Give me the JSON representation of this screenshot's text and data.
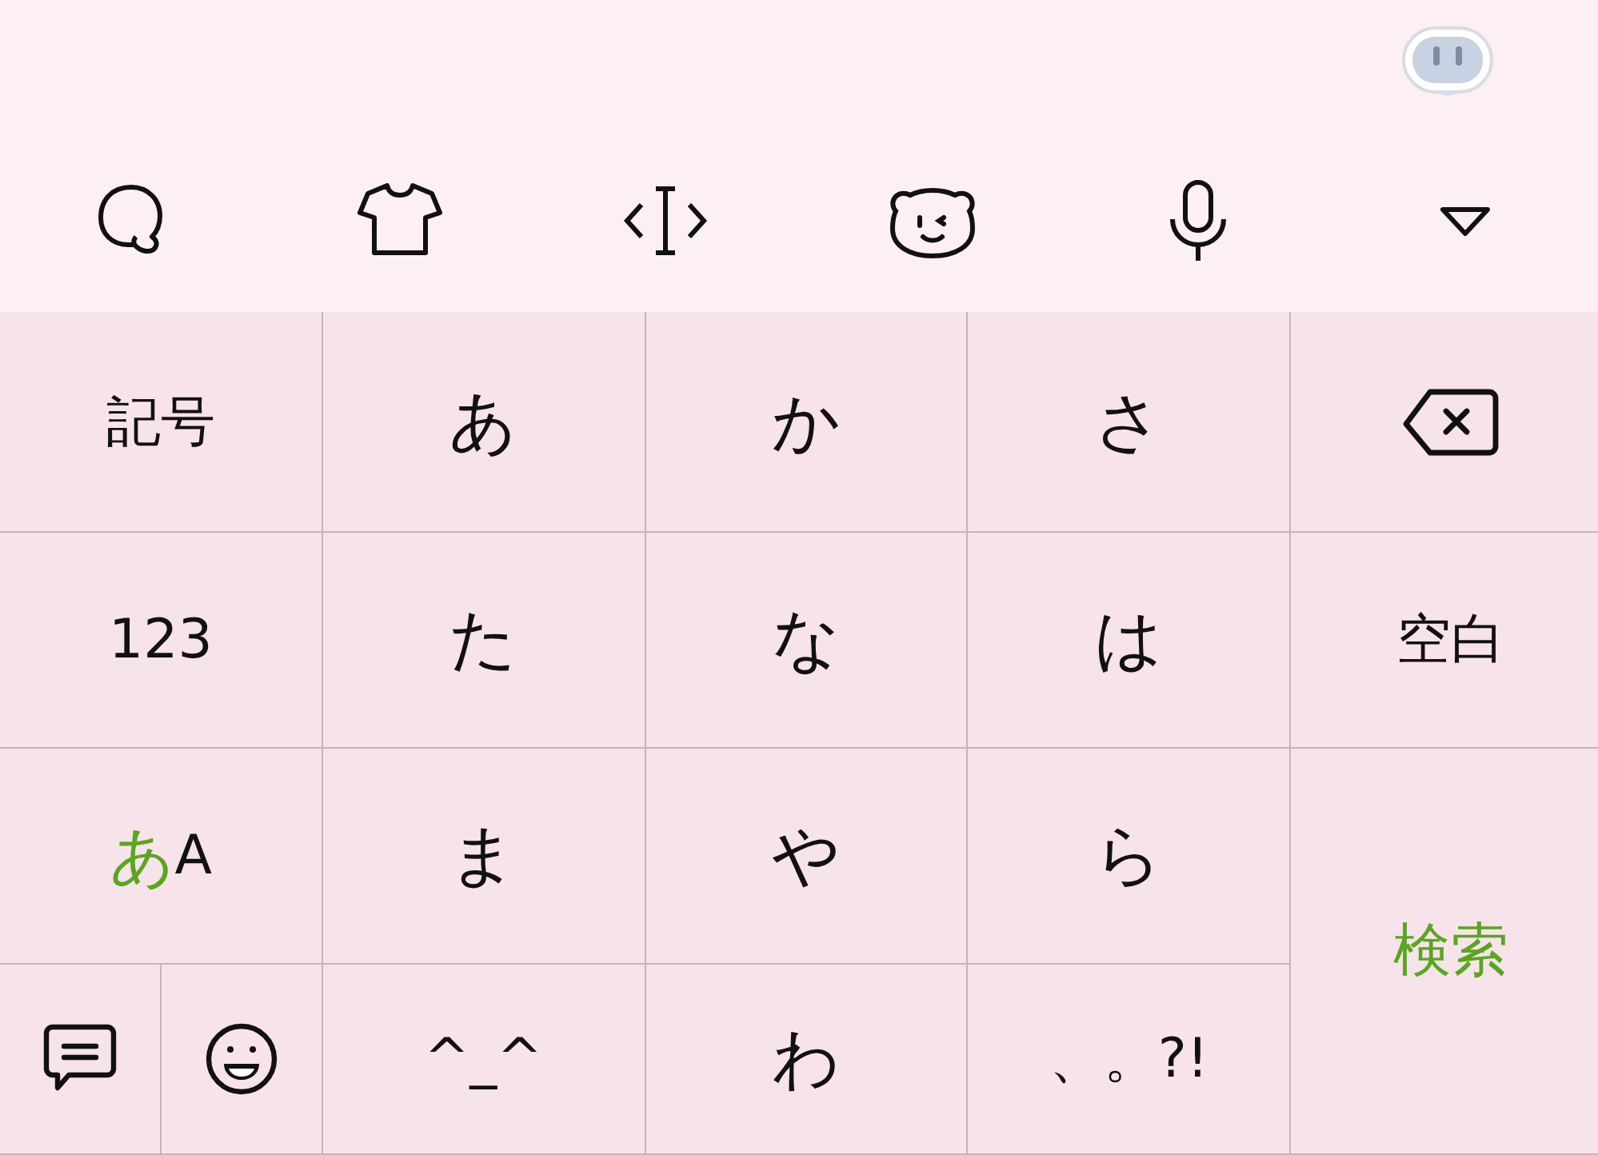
{
  "toolbar": {
    "tools": [
      {
        "kind": "chat"
      },
      {
        "kind": "shirt"
      },
      {
        "kind": "cursor"
      },
      {
        "kind": "bear"
      },
      {
        "kind": "mic"
      },
      {
        "kind": "collapse"
      }
    ]
  },
  "keys": [
    {
      "kind": "text",
      "label": "記号"
    },
    {
      "kind": "text",
      "label": "あ"
    },
    {
      "kind": "text",
      "label": "か"
    },
    {
      "kind": "text",
      "label": "さ"
    },
    {
      "kind": "backspace"
    },
    {
      "kind": "text",
      "label": "123"
    },
    {
      "kind": "text",
      "label": "た"
    },
    {
      "kind": "text",
      "label": "な"
    },
    {
      "kind": "text",
      "label": "は"
    },
    {
      "kind": "text",
      "label": "空白"
    },
    {
      "kind": "mode",
      "options": [
        {
          "label": "あ",
          "selected": true
        },
        {
          "label": "A",
          "selected": false
        }
      ]
    },
    {
      "kind": "text",
      "label": "ま"
    },
    {
      "kind": "text",
      "label": "や"
    },
    {
      "kind": "text",
      "label": "ら"
    },
    {
      "kind": "enter",
      "label": "検索"
    },
    {
      "kind": "comment"
    },
    {
      "kind": "emoji"
    },
    {
      "kind": "text",
      "label": "^_^"
    },
    {
      "kind": "text",
      "label": "わ"
    },
    {
      "kind": "text",
      "label": "、。?!"
    }
  ]
}
